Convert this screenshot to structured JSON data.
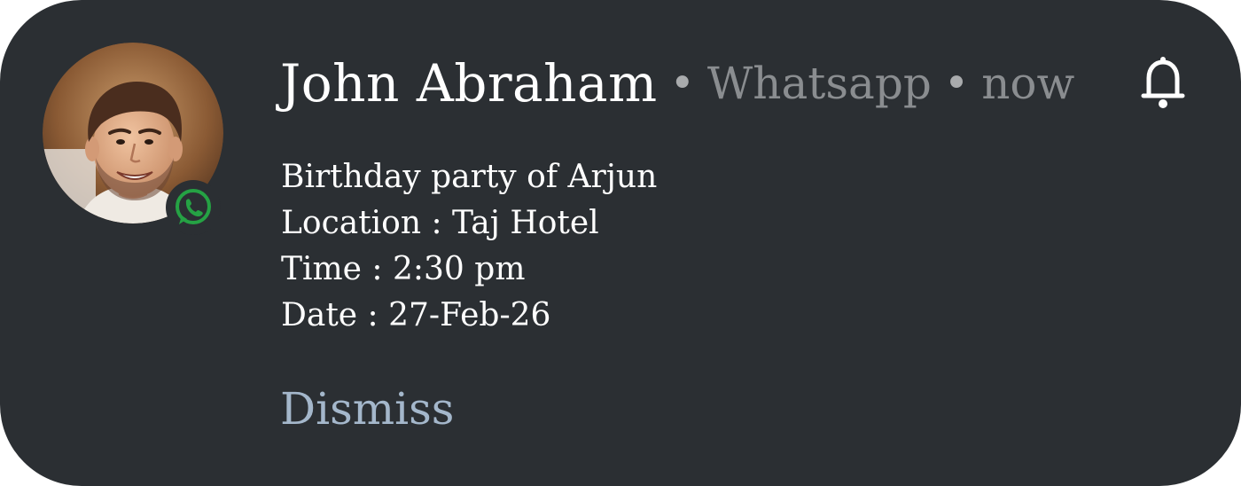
{
  "notification": {
    "sender": "John Abraham",
    "separator": "•",
    "app_name": "Whatsapp",
    "time": "now",
    "lines": [
      "Birthday party of Arjun",
      "Location : Taj Hotel",
      "Time : 2:30 pm",
      "Date : 27-Feb-26"
    ],
    "dismiss_label": "Dismiss",
    "bell_icon": "bell-icon",
    "app_badge_icon": "whatsapp-icon",
    "avatar_icon": "contact-avatar"
  },
  "colors": {
    "card_background": "#2b2f33",
    "primary_text": "#ffffff",
    "secondary_text": "#8a8d90",
    "dismiss_text": "#a4b7cb",
    "whatsapp_green": "#25a244"
  }
}
